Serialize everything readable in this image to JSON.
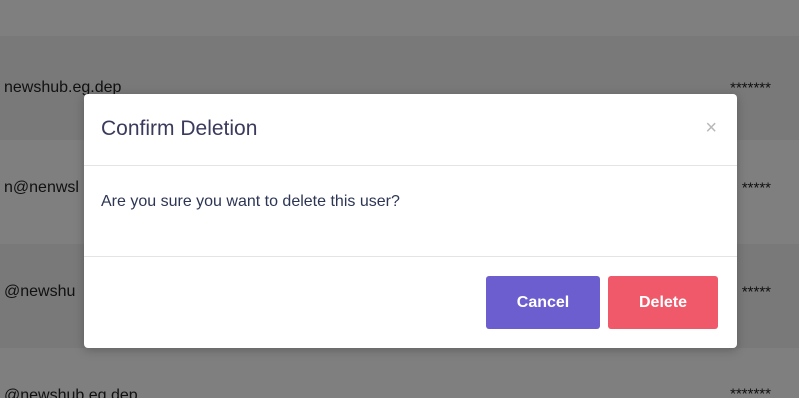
{
  "background_table": {
    "rows": [
      {
        "email": "",
        "password": ""
      },
      {
        "email": "newshub.eg.dep",
        "password": "*******"
      },
      {
        "email": "n@nenwsl",
        "password": "*****"
      },
      {
        "email": "@newshu",
        "password": "*****"
      },
      {
        "email": "@newshub.eg.dep",
        "password": "*******"
      }
    ]
  },
  "modal": {
    "title": "Confirm Deletion",
    "close_symbol": "×",
    "message": "Are you sure you want to delete this user?",
    "cancel_label": "Cancel",
    "delete_label": "Delete"
  },
  "colors": {
    "cancel_button": "#6c5ecf",
    "delete_button": "#f0596a",
    "title_text": "#3a3a5c",
    "overlay": "rgba(0,0,0,0.5)"
  }
}
